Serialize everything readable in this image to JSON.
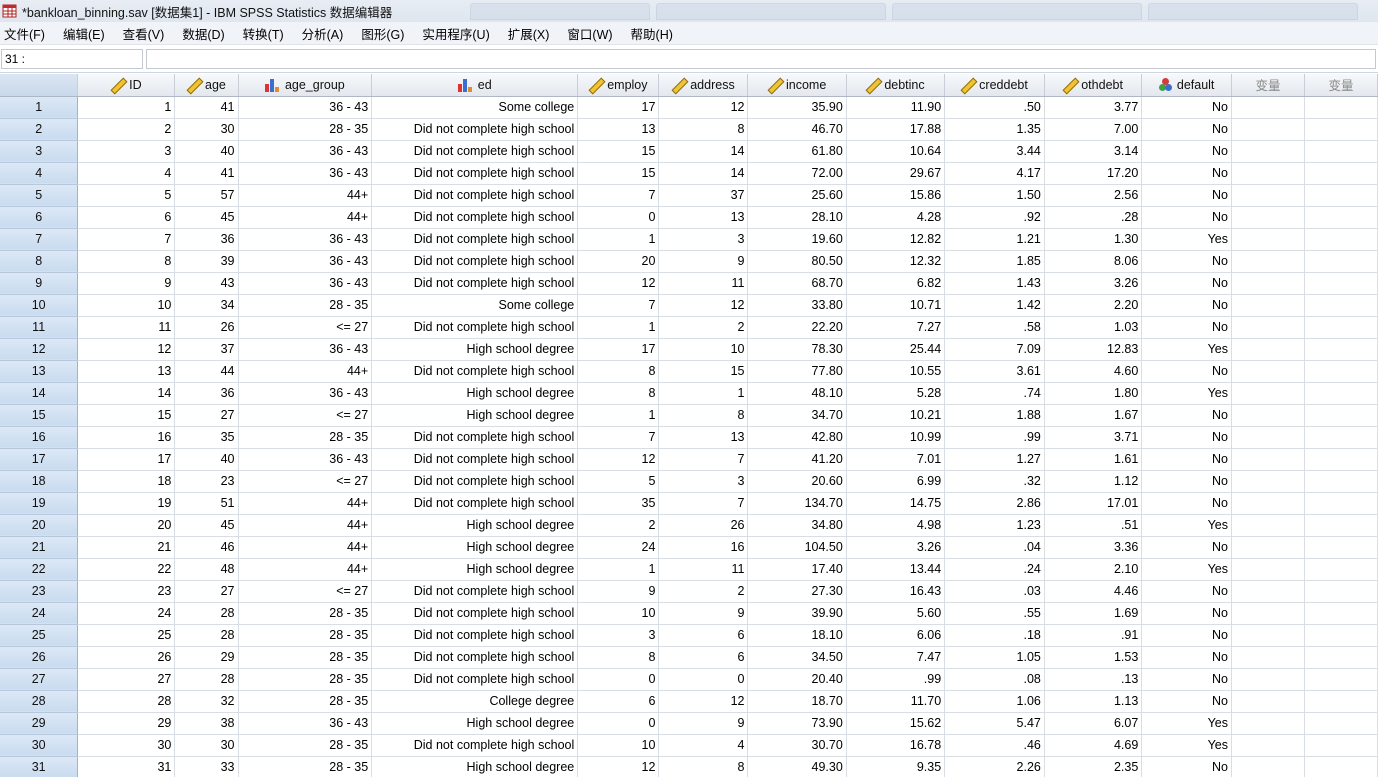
{
  "window": {
    "title": "*bankloan_binning.sav [数据集1] - IBM SPSS Statistics 数据编辑器"
  },
  "menu": [
    "文件(F)",
    "编辑(E)",
    "查看(V)",
    "数据(D)",
    "转换(T)",
    "分析(A)",
    "图形(G)",
    "实用程序(U)",
    "扩展(X)",
    "窗口(W)",
    "帮助(H)"
  ],
  "cell_editor": {
    "reference": "31 :",
    "value": ""
  },
  "columns": [
    {
      "name": "ID",
      "icon": "scale-ruler-icon"
    },
    {
      "name": "age",
      "icon": "scale-ruler-icon"
    },
    {
      "name": "age_group",
      "icon": "ordinal-bar-icon"
    },
    {
      "name": "ed",
      "icon": "ordinal-bar-icon"
    },
    {
      "name": "employ",
      "icon": "scale-ruler-icon"
    },
    {
      "name": "address",
      "icon": "scale-ruler-icon"
    },
    {
      "name": "income",
      "icon": "scale-ruler-icon"
    },
    {
      "name": "debtinc",
      "icon": "scale-ruler-icon"
    },
    {
      "name": "creddebt",
      "icon": "scale-ruler-icon"
    },
    {
      "name": "othdebt",
      "icon": "scale-ruler-icon"
    },
    {
      "name": "default",
      "icon": "nominal-circles-icon"
    }
  ],
  "placeholder_columns": [
    "变量",
    "变量"
  ],
  "rows": [
    [
      "1",
      "41",
      "36 - 43",
      "Some college",
      "17",
      "12",
      "35.90",
      "11.90",
      ".50",
      "3.77",
      "No"
    ],
    [
      "2",
      "30",
      "28 - 35",
      "Did not complete high school",
      "13",
      "8",
      "46.70",
      "17.88",
      "1.35",
      "7.00",
      "No"
    ],
    [
      "3",
      "40",
      "36 - 43",
      "Did not complete high school",
      "15",
      "14",
      "61.80",
      "10.64",
      "3.44",
      "3.14",
      "No"
    ],
    [
      "4",
      "41",
      "36 - 43",
      "Did not complete high school",
      "15",
      "14",
      "72.00",
      "29.67",
      "4.17",
      "17.20",
      "No"
    ],
    [
      "5",
      "57",
      "44+",
      "Did not complete high school",
      "7",
      "37",
      "25.60",
      "15.86",
      "1.50",
      "2.56",
      "No"
    ],
    [
      "6",
      "45",
      "44+",
      "Did not complete high school",
      "0",
      "13",
      "28.10",
      "4.28",
      ".92",
      ".28",
      "No"
    ],
    [
      "7",
      "36",
      "36 - 43",
      "Did not complete high school",
      "1",
      "3",
      "19.60",
      "12.82",
      "1.21",
      "1.30",
      "Yes"
    ],
    [
      "8",
      "39",
      "36 - 43",
      "Did not complete high school",
      "20",
      "9",
      "80.50",
      "12.32",
      "1.85",
      "8.06",
      "No"
    ],
    [
      "9",
      "43",
      "36 - 43",
      "Did not complete high school",
      "12",
      "11",
      "68.70",
      "6.82",
      "1.43",
      "3.26",
      "No"
    ],
    [
      "10",
      "34",
      "28 - 35",
      "Some college",
      "7",
      "12",
      "33.80",
      "10.71",
      "1.42",
      "2.20",
      "No"
    ],
    [
      "11",
      "26",
      "<= 27",
      "Did not complete high school",
      "1",
      "2",
      "22.20",
      "7.27",
      ".58",
      "1.03",
      "No"
    ],
    [
      "12",
      "37",
      "36 - 43",
      "High school degree",
      "17",
      "10",
      "78.30",
      "25.44",
      "7.09",
      "12.83",
      "Yes"
    ],
    [
      "13",
      "44",
      "44+",
      "Did not complete high school",
      "8",
      "15",
      "77.80",
      "10.55",
      "3.61",
      "4.60",
      "No"
    ],
    [
      "14",
      "36",
      "36 - 43",
      "High school degree",
      "8",
      "1",
      "48.10",
      "5.28",
      ".74",
      "1.80",
      "Yes"
    ],
    [
      "15",
      "27",
      "<= 27",
      "High school degree",
      "1",
      "8",
      "34.70",
      "10.21",
      "1.88",
      "1.67",
      "No"
    ],
    [
      "16",
      "35",
      "28 - 35",
      "Did not complete high school",
      "7",
      "13",
      "42.80",
      "10.99",
      ".99",
      "3.71",
      "No"
    ],
    [
      "17",
      "40",
      "36 - 43",
      "Did not complete high school",
      "12",
      "7",
      "41.20",
      "7.01",
      "1.27",
      "1.61",
      "No"
    ],
    [
      "18",
      "23",
      "<= 27",
      "Did not complete high school",
      "5",
      "3",
      "20.60",
      "6.99",
      ".32",
      "1.12",
      "No"
    ],
    [
      "19",
      "51",
      "44+",
      "Did not complete high school",
      "35",
      "7",
      "134.70",
      "14.75",
      "2.86",
      "17.01",
      "No"
    ],
    [
      "20",
      "45",
      "44+",
      "High school degree",
      "2",
      "26",
      "34.80",
      "4.98",
      "1.23",
      ".51",
      "Yes"
    ],
    [
      "21",
      "46",
      "44+",
      "High school degree",
      "24",
      "16",
      "104.50",
      "3.26",
      ".04",
      "3.36",
      "No"
    ],
    [
      "22",
      "48",
      "44+",
      "High school degree",
      "1",
      "11",
      "17.40",
      "13.44",
      ".24",
      "2.10",
      "Yes"
    ],
    [
      "23",
      "27",
      "<= 27",
      "Did not complete high school",
      "9",
      "2",
      "27.30",
      "16.43",
      ".03",
      "4.46",
      "No"
    ],
    [
      "24",
      "28",
      "28 - 35",
      "Did not complete high school",
      "10",
      "9",
      "39.90",
      "5.60",
      ".55",
      "1.69",
      "No"
    ],
    [
      "25",
      "28",
      "28 - 35",
      "Did not complete high school",
      "3",
      "6",
      "18.10",
      "6.06",
      ".18",
      ".91",
      "No"
    ],
    [
      "26",
      "29",
      "28 - 35",
      "Did not complete high school",
      "8",
      "6",
      "34.50",
      "7.47",
      "1.05",
      "1.53",
      "No"
    ],
    [
      "27",
      "28",
      "28 - 35",
      "Did not complete high school",
      "0",
      "0",
      "20.40",
      ".99",
      ".08",
      ".13",
      "No"
    ],
    [
      "28",
      "32",
      "28 - 35",
      "College degree",
      "6",
      "12",
      "18.70",
      "11.70",
      "1.06",
      "1.13",
      "No"
    ],
    [
      "29",
      "38",
      "36 - 43",
      "High school degree",
      "0",
      "9",
      "73.90",
      "15.62",
      "5.47",
      "6.07",
      "Yes"
    ],
    [
      "30",
      "30",
      "28 - 35",
      "Did not complete high school",
      "10",
      "4",
      "30.70",
      "16.78",
      ".46",
      "4.69",
      "Yes"
    ],
    [
      "31",
      "33",
      "28 - 35",
      "High school degree",
      "12",
      "8",
      "49.30",
      "9.35",
      "2.26",
      "2.35",
      "No"
    ]
  ]
}
